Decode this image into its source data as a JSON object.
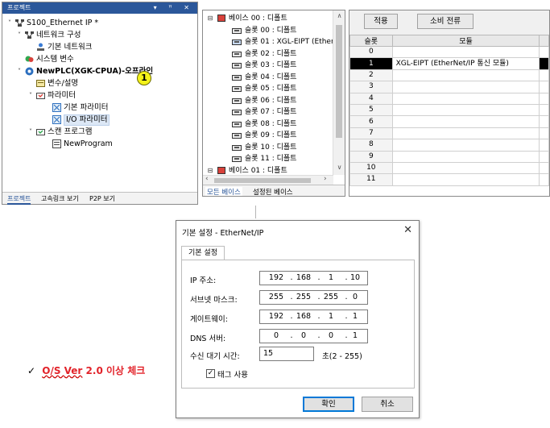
{
  "project": {
    "title": "프로젝트",
    "controls": "▾ ꟸ ✕",
    "tree": [
      {
        "label": "S100_Ethernet IP *",
        "bold": false
      },
      {
        "label": "네트워크 구성",
        "bold": false
      },
      {
        "label": "기본 네트워크",
        "bold": false
      },
      {
        "label": "시스템 변수",
        "bold": false
      },
      {
        "label": "NewPLC(XGK-CPUA)-오프라인",
        "bold": true
      },
      {
        "label": "변수/설명",
        "bold": false
      },
      {
        "label": "파라미터",
        "bold": false
      },
      {
        "label": "기본 파라미터",
        "bold": false
      },
      {
        "label": "I/O 파라미터",
        "bold": false
      },
      {
        "label": "스캔 프로그램",
        "bold": false
      },
      {
        "label": "NewProgram",
        "bold": false
      }
    ],
    "tabs": [
      "프로젝트",
      "고속링크 보기",
      "P2P 보기"
    ]
  },
  "callout": "1",
  "base": {
    "tree": [
      "베이스 00 : 디폴트",
      "슬롯 00 : 디폴트",
      "슬롯 01 : XGL-EIPT (Ether",
      "슬롯 02 : 디폴트",
      "슬롯 03 : 디폴트",
      "슬롯 04 : 디폴트",
      "슬롯 05 : 디폴트",
      "슬롯 06 : 디폴트",
      "슬롯 07 : 디폴트",
      "슬롯 08 : 디폴트",
      "슬롯 09 : 디폴트",
      "슬롯 10 : 디폴트",
      "슬롯 11 : 디폴트",
      "베이스 01 : 디폴트"
    ],
    "tabs": [
      "모든 베이스",
      "설정된 베이스"
    ]
  },
  "slot_table": {
    "buttons": [
      "적용",
      "소비 전류"
    ],
    "headers": [
      "슬롯",
      "모듈"
    ],
    "rows": [
      {
        "slot": "0",
        "module": ""
      },
      {
        "slot": "1",
        "module": "XGL-EIPT (EtherNet/IP 통신 모듈)"
      },
      {
        "slot": "2",
        "module": ""
      },
      {
        "slot": "3",
        "module": ""
      },
      {
        "slot": "4",
        "module": ""
      },
      {
        "slot": "5",
        "module": ""
      },
      {
        "slot": "6",
        "module": ""
      },
      {
        "slot": "7",
        "module": ""
      },
      {
        "slot": "8",
        "module": ""
      },
      {
        "slot": "9",
        "module": ""
      },
      {
        "slot": "10",
        "module": ""
      },
      {
        "slot": "11",
        "module": ""
      }
    ]
  },
  "dialog": {
    "title": "기본 설정 - EtherNet/IP",
    "close": "✕",
    "tab": "기본 설정",
    "fields": {
      "ip": {
        "label": "IP 주소:",
        "octets": [
          "192",
          "168",
          "1",
          "10"
        ]
      },
      "subnet": {
        "label": "서브넷 마스크:",
        "octets": [
          "255",
          "255",
          "255",
          "0"
        ]
      },
      "gateway": {
        "label": "게이트웨이:",
        "octets": [
          "192",
          "168",
          "1",
          "1"
        ]
      },
      "dns": {
        "label": "DNS 서버:",
        "octets": [
          "0",
          "0",
          "0",
          "1"
        ]
      }
    },
    "timeout": {
      "label": "수신 대기 시간:",
      "value": "15",
      "range": "초(2 - 255)"
    },
    "tag": {
      "label": "태그 사용",
      "checked": true
    },
    "ok": "확인",
    "cancel": "취소"
  },
  "note": {
    "check": "✓",
    "os_ver": "O/S Ver",
    "rest": "2.0 이상 체크"
  }
}
